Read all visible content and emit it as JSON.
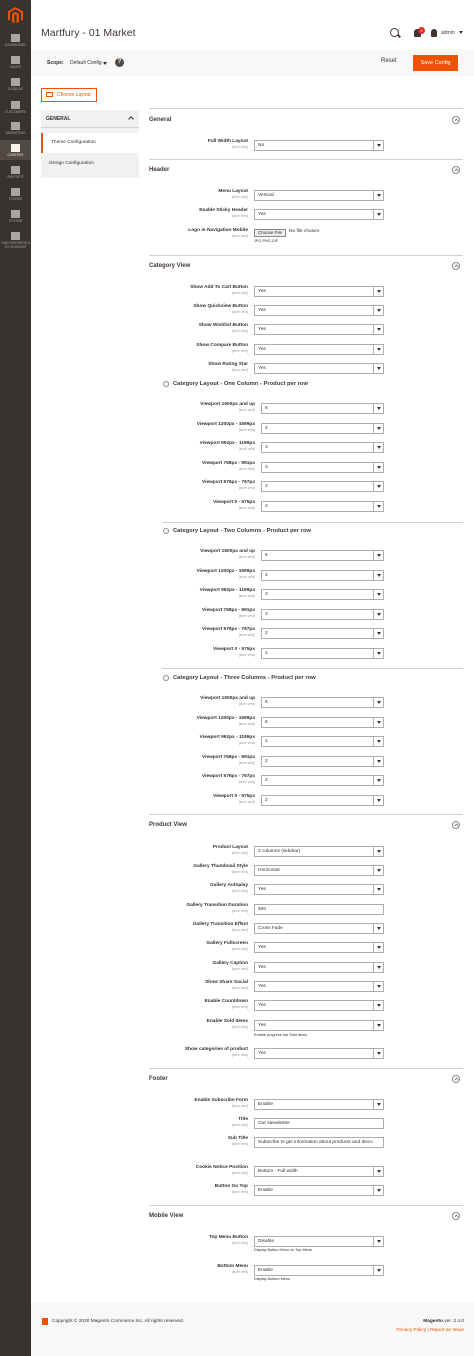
{
  "sidebar": [
    {
      "label": "DASHBOARD",
      "icon": "dashboard-icon"
    },
    {
      "label": "SALES",
      "icon": "dollar-icon"
    },
    {
      "label": "CATALOG",
      "icon": "cube-icon"
    },
    {
      "label": "CUSTOMERS",
      "icon": "user-icon"
    },
    {
      "label": "MARKETING",
      "icon": "megaphone-icon"
    },
    {
      "label": "CONTENT",
      "icon": "layout-icon"
    },
    {
      "label": "REPORTS",
      "icon": "bar-chart-icon"
    },
    {
      "label": "STORES",
      "icon": "store-icon"
    },
    {
      "label": "SYSTEM",
      "icon": "gear-icon"
    },
    {
      "label": "FIND PARTNERS & EXTENSIONS",
      "icon": "boxes-icon"
    }
  ],
  "header": {
    "title": "Martfury - 01 Market",
    "notifications": "3",
    "user": "admin"
  },
  "scope": {
    "label": "Scope:",
    "value": "Default Config",
    "help": "?",
    "reset": "Reset",
    "save": "Save Config"
  },
  "choose_layout": "Choose Layout",
  "leftnav": {
    "head": "GENERAL",
    "items": [
      "Theme Configuration",
      "Design Configuration"
    ]
  },
  "store_view": "[store view]",
  "sections": {
    "general": "General",
    "header": "Header",
    "category": "Category View",
    "cat_one": "Category Layout - One Column - Product per row",
    "cat_two": "Category Layout - Two Columns - Product per row",
    "cat_three": "Category Layout - Three Columns - Product per row",
    "product": "Product View",
    "footer": "Footer",
    "mobile": "Mobile View"
  },
  "fields": {
    "full_width": {
      "label": "Full Width Layout",
      "value": "No"
    },
    "menu_layout": {
      "label": "Menu Layout",
      "value": "Vertical"
    },
    "sticky": {
      "label": "Enable Sticky Header",
      "value": "Yes"
    },
    "logo_mobile": {
      "label": "Logo in Navigation Mobile",
      "button": "Choose File",
      "status": "No file chosen",
      "note": "JPG,PNG,GIF"
    },
    "add_cart": {
      "label": "Show Add To Cart Button",
      "value": "Yes"
    },
    "quickview": {
      "label": "Show Quickview Button",
      "value": "Yes"
    },
    "wishlist": {
      "label": "Show Wishlist Button",
      "value": "Yes"
    },
    "compare": {
      "label": "Show Compare Button",
      "value": "Yes"
    },
    "rating": {
      "label": "Show Rating Star",
      "value": "Yes"
    },
    "product_layout": {
      "label": "Product Layout",
      "value": "3 columns (sidebar)"
    },
    "thumb_style": {
      "label": "Gallery Thumbnail Style",
      "value": "Horizontal"
    },
    "autoplay": {
      "label": "Gallery Autoplay",
      "value": "Yes"
    },
    "duration": {
      "label": "Gallery Transition Duration",
      "value": "600"
    },
    "effect": {
      "label": "Gallery Transition Effect",
      "value": "Cross Fade"
    },
    "fullscreen": {
      "label": "Gallery Fullscreen",
      "value": "Yes"
    },
    "caption": {
      "label": "Gallery Caption",
      "value": "Yes"
    },
    "share": {
      "label": "Show Share Social",
      "value": "Yes"
    },
    "countdown": {
      "label": "Enable Countdown",
      "value": "Yes"
    },
    "sold": {
      "label": "Enable Sold Items",
      "value": "Yes",
      "note": "Enable progress bar Sold Items"
    },
    "show_cats": {
      "label": "Show categories of product",
      "value": "Yes"
    },
    "subscribe": {
      "label": "Enable Subscribe Form",
      "value": "Enable"
    },
    "title": {
      "label": "Title",
      "value": "Our Newsletter"
    },
    "subtitle": {
      "label": "Sub Title",
      "value": "Subscribe to get information about products and disco"
    },
    "cookie": {
      "label": "Cookie Notice Position",
      "value": "Bottom - Full width"
    },
    "gotop": {
      "label": "Button Go Top",
      "value": "Enable"
    },
    "top_menu": {
      "label": "Top Menu Button",
      "value": "Disable",
      "note": "Display Button Menu on Top Menu"
    },
    "bottom_menu": {
      "label": "Bottom Menu",
      "value": "Enable",
      "note": "Display Bottom Menu"
    }
  },
  "viewports": [
    "Viewport 1600px and up",
    "Viewport 1200px - 1599px",
    "Viewport 992px - 1199px",
    "Viewport 768px - 991px",
    "Viewport 576px - 767px",
    "Viewport 0 - 575px"
  ],
  "cat_one_values": [
    "6",
    "4",
    "3",
    "3",
    "2",
    "2"
  ],
  "cat_two_values": [
    "6",
    "4",
    "3",
    "3",
    "2",
    "2"
  ],
  "cat_three_values": [
    "6",
    "6",
    "2",
    "2",
    "2",
    "2"
  ],
  "footer": {
    "copyright": "Copyright © 2020 Magento Commerce Inc. All rights reserved.",
    "brand": "Magento",
    "version": "ver. 2.4.0",
    "privacy": "Privacy Policy",
    "sep": " | ",
    "report": "Report an Issue"
  }
}
